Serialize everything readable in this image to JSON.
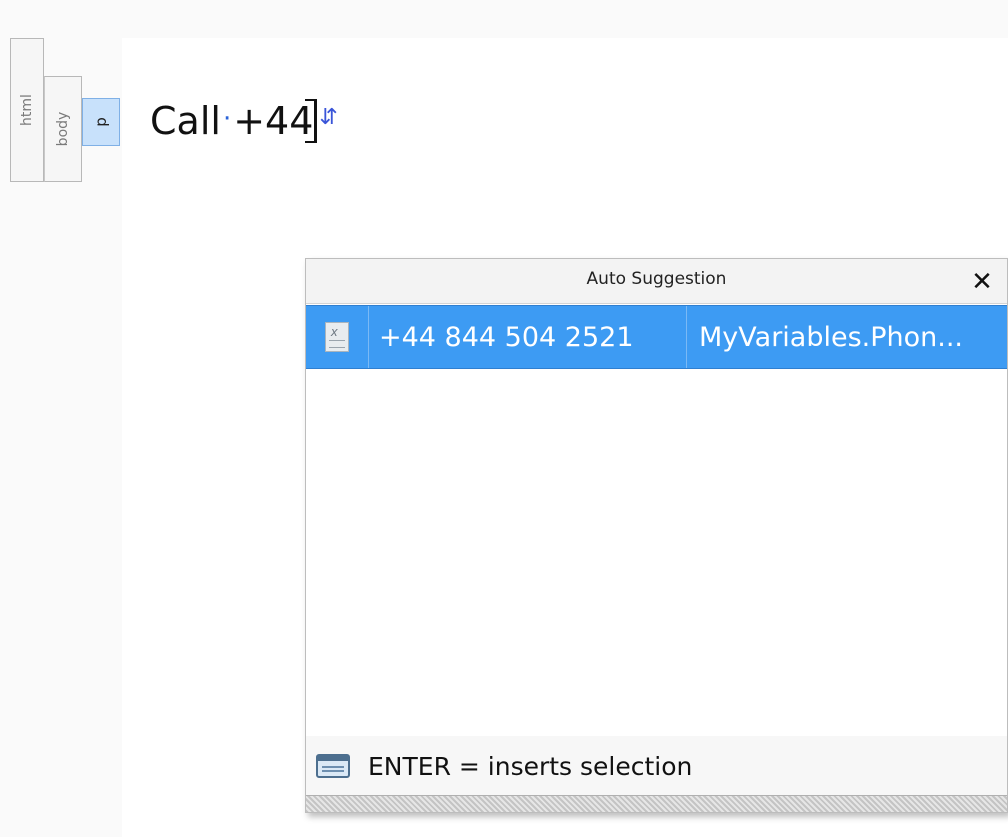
{
  "tag_tabs": {
    "html": "html",
    "body": "body",
    "p": "p"
  },
  "editor": {
    "text_before_space": "Call",
    "space_marker": "·",
    "text_after_space": "+44",
    "paragraph_marker": "⇵"
  },
  "popup": {
    "title": "Auto Suggestion",
    "close_label": "✕",
    "suggestions": [
      {
        "icon": "variable-doc-icon",
        "value": "+44 844 504 2521",
        "source": "MyVariables.Phon..."
      }
    ],
    "footer_hint": "ENTER = inserts selection",
    "footer_icon": "keyboard-icon"
  },
  "colors": {
    "selection": "#3d9bf3",
    "tag_active": "#c8e1fb",
    "space_marker": "#2b63d8"
  }
}
